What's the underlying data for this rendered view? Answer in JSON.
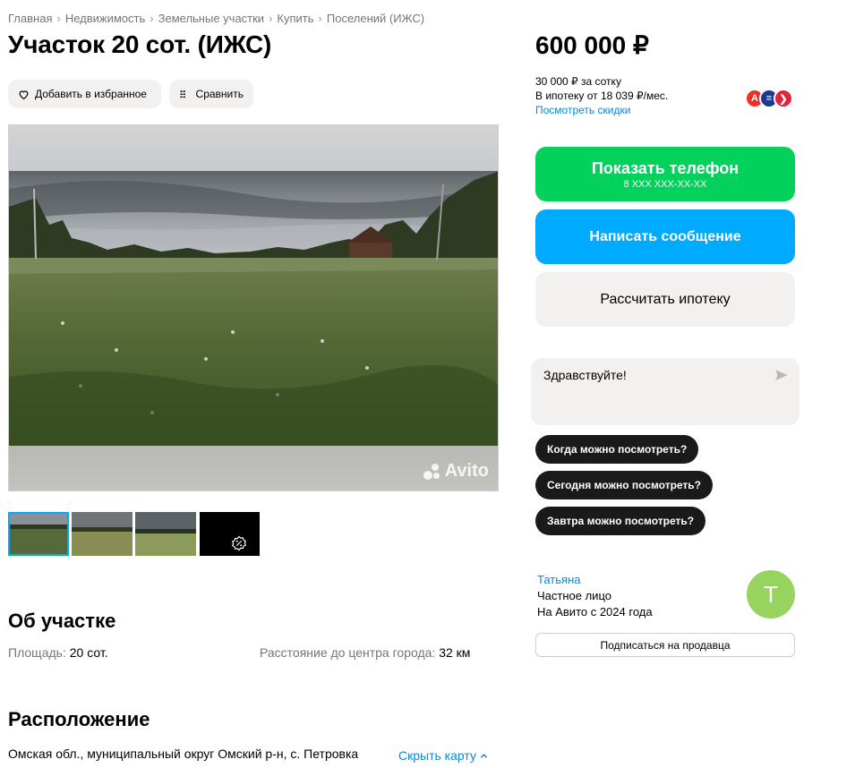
{
  "breadcrumbs": [
    "Главная",
    "Недвижимость",
    "Земельные участки",
    "Купить",
    "Поселений (ИЖС)"
  ],
  "breadcrumb_separator": "›",
  "title": "Участок 20 сот. (ИЖС)",
  "actions": {
    "favorite_label": "Добавить в избранное",
    "compare_label": "Сравнить"
  },
  "gallery": {
    "watermark": "Avito",
    "thumbnail_count": 4
  },
  "about": {
    "heading": "Об участке",
    "area_label": "Площадь:",
    "area_value": "20 сот.",
    "distance_label": "Расстояние до центра города:",
    "distance_value": "32 км"
  },
  "location": {
    "heading": "Расположение",
    "address": "Омская обл., муниципальный округ Омский р-н, с. Петровка",
    "hide_map_label": "Скрыть карту"
  },
  "price": {
    "amount": "600 000 ₽",
    "per_sotka": "30 000 ₽ за сотку",
    "mortgage_from": "В ипотеку от 18 039 ₽/мес.",
    "discounts_link": "Посмотреть скидки"
  },
  "banks": [
    "А",
    "≡",
    "❯"
  ],
  "buttons": {
    "show_phone": "Показать телефон",
    "phone_mask": "8 XXX XXX-XX-XX",
    "write_message": "Написать сообщение",
    "calc_mortgage": "Рассчитать ипотеку"
  },
  "chat": {
    "greeting": "Здравствуйте!"
  },
  "quick_questions": [
    "Когда можно посмотреть?",
    "Сегодня можно посмотреть?",
    "Завтра можно посмотреть?"
  ],
  "seller": {
    "name": "Татьяна",
    "type": "Частное лицо",
    "since": "На Авито с 2024 года",
    "avatar_letter": "Т",
    "subscribe_label": "Подписаться на продавца"
  },
  "colors": {
    "green": "#02d15c",
    "blue": "#00aaff",
    "link": "#0a88d6",
    "avatar": "#96d35f"
  }
}
